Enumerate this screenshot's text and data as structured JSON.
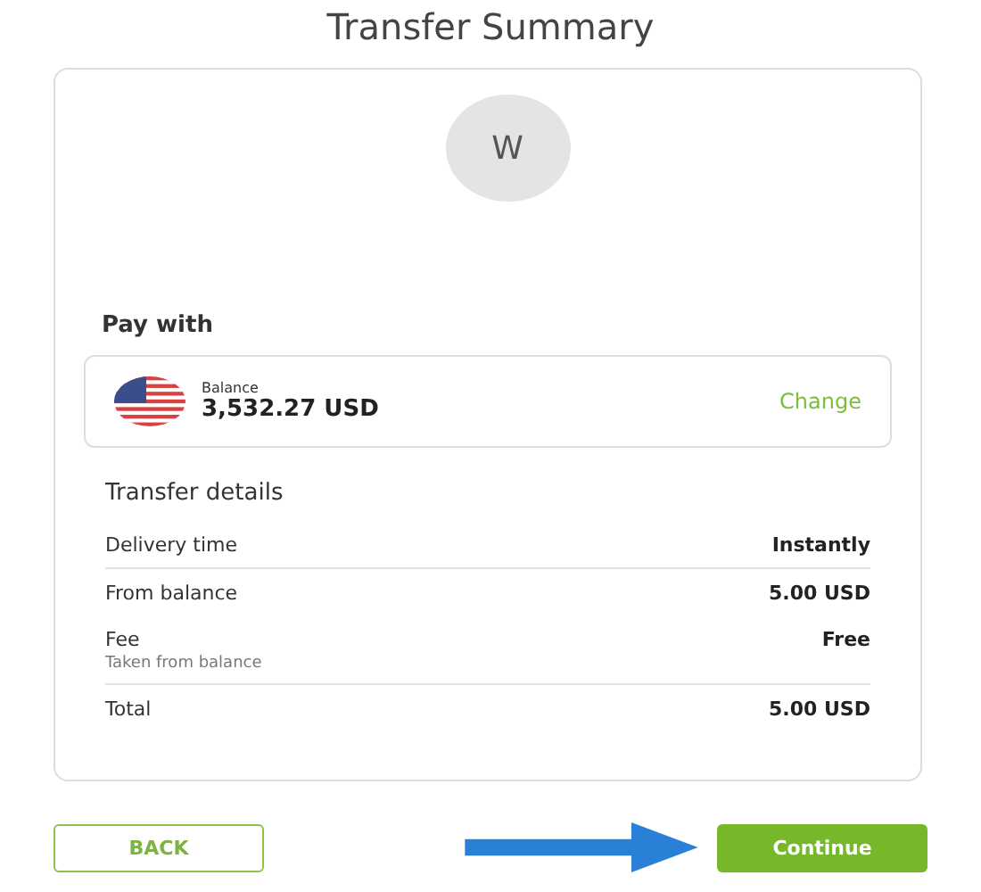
{
  "title": "Transfer Summary",
  "avatar": {
    "initial": "W"
  },
  "pay_with": {
    "label": "Pay with",
    "balance_label": "Balance",
    "balance": "3,532.27 USD",
    "change": "Change"
  },
  "details": {
    "heading": "Transfer details",
    "rows": [
      {
        "label": "Delivery time",
        "value": "Instantly",
        "divider": true
      },
      {
        "label": "From balance",
        "value": "5.00 USD",
        "divider": false
      },
      {
        "label": "Fee",
        "note": "Taken from balance",
        "value": "Free",
        "divider": true
      },
      {
        "label": "Total",
        "value": "5.00 USD",
        "divider": false
      }
    ]
  },
  "buttons": [
    {
      "label": "BACK",
      "kind": "outline"
    },
    {
      "label": "Continue",
      "kind": "primary"
    }
  ]
}
